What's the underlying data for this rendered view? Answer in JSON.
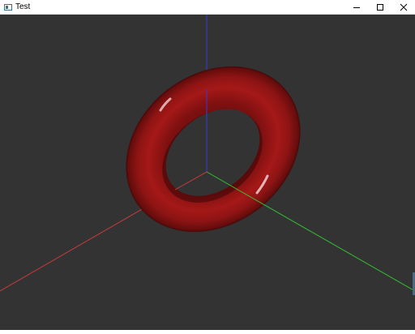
{
  "window": {
    "title": "Test",
    "controls": {
      "minimize_icon": "minimize-icon",
      "maximize_icon": "maximize-icon",
      "close_icon": "close-icon"
    }
  },
  "scene": {
    "background": "#333333",
    "axes": {
      "x_color": "#d94141",
      "y_color": "#3aa33a",
      "z_color": "#3b3bd6"
    },
    "torus_color": "#9a1414"
  }
}
